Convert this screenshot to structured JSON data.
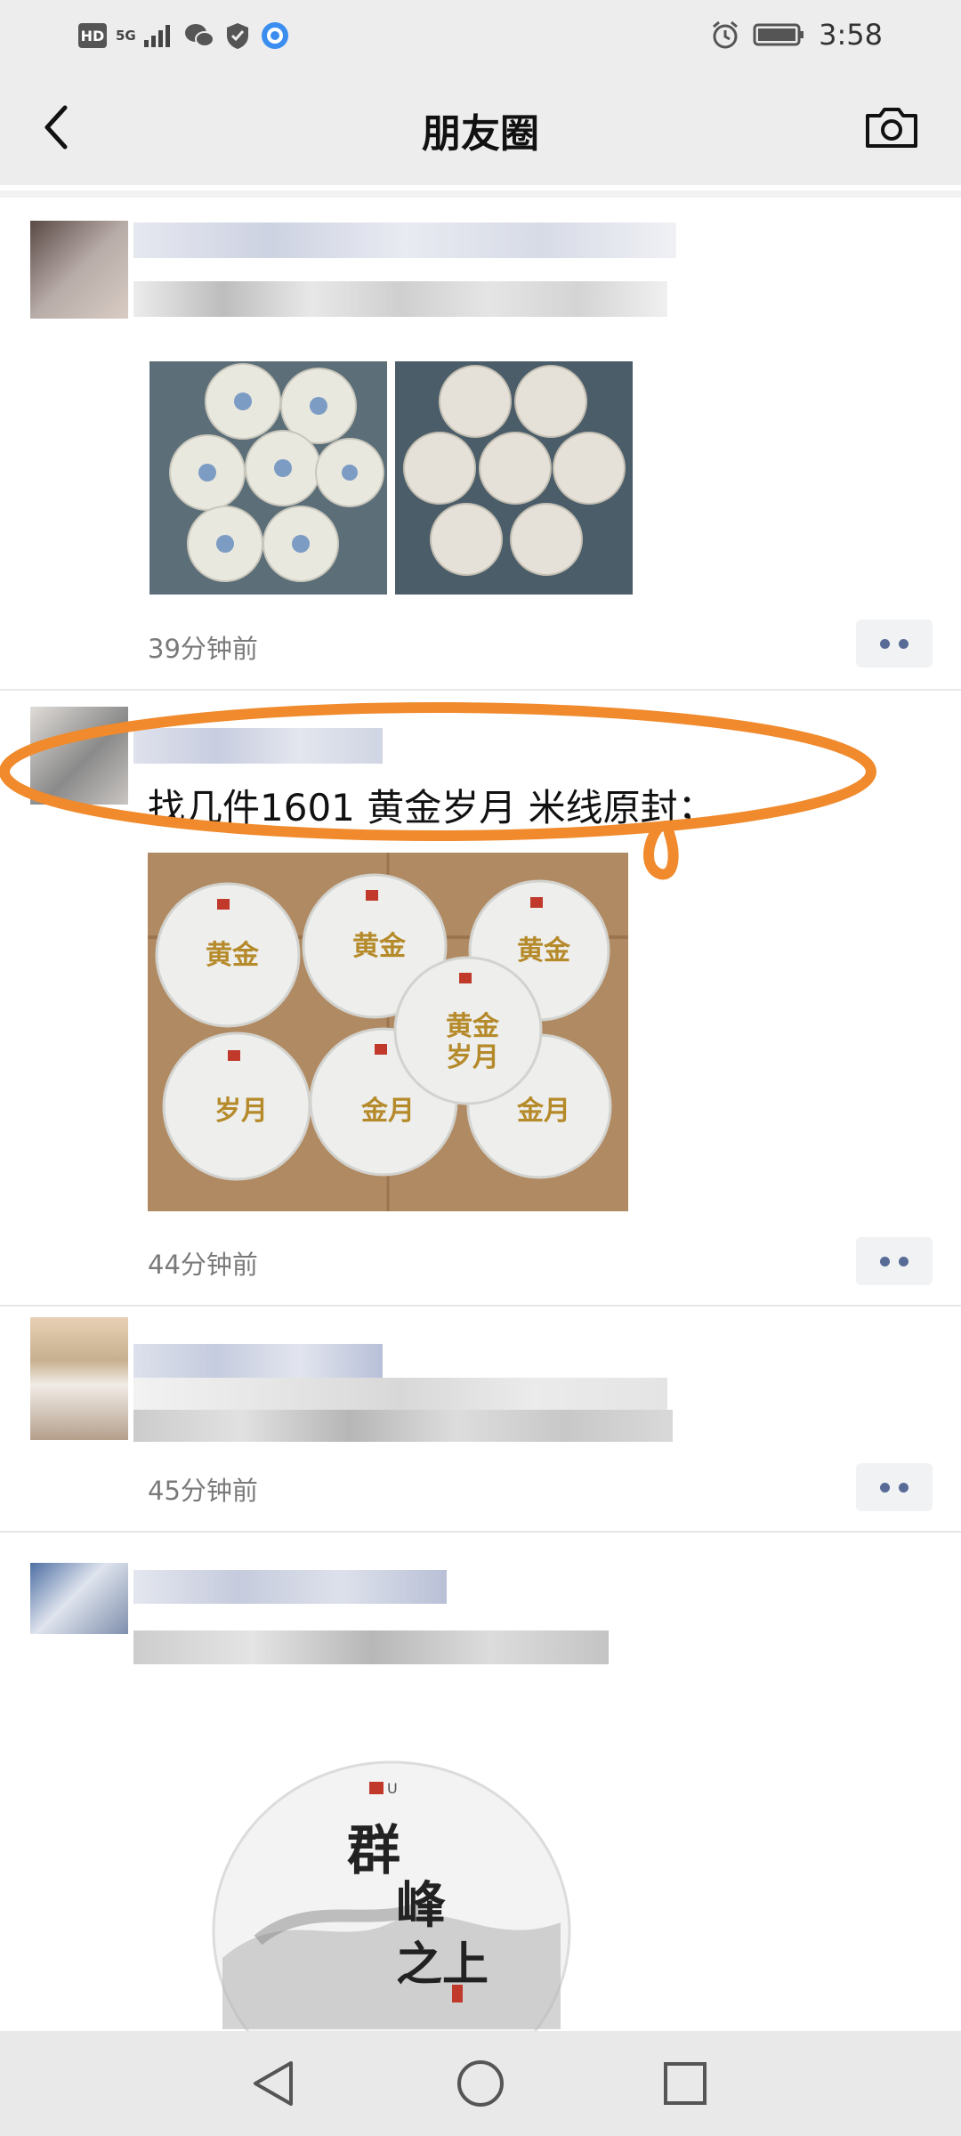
{
  "status_bar": {
    "hd": "HD",
    "network": "5G",
    "time": "3:58"
  },
  "nav": {
    "title": "朋友圈"
  },
  "posts": [
    {
      "timestamp": "39分钟前"
    },
    {
      "text": "找几件1601 黄金岁月 米线原封；",
      "timestamp": "44分钟前"
    },
    {
      "timestamp": "45分钟前"
    }
  ],
  "images": {
    "post2_cake_label": "黄金岁月",
    "post4_cake_label": "群峰之上"
  },
  "icons": {
    "back": "back-arrow-icon",
    "camera": "camera-icon",
    "more": "more-dots-icon",
    "nav_back": "triangle-back-icon",
    "nav_home": "circle-home-icon",
    "nav_recent": "square-recent-icon"
  },
  "colors": {
    "header_bg": "#ededed",
    "link_blue": "#586b96",
    "annotation_orange": "#f08a2c"
  }
}
